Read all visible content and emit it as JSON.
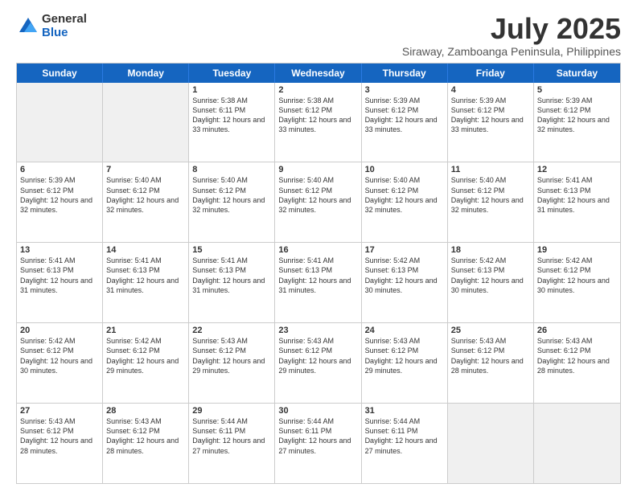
{
  "logo": {
    "general": "General",
    "blue": "Blue"
  },
  "title": "July 2025",
  "subtitle": "Siraway, Zamboanga Peninsula, Philippines",
  "headers": [
    "Sunday",
    "Monday",
    "Tuesday",
    "Wednesday",
    "Thursday",
    "Friday",
    "Saturday"
  ],
  "weeks": [
    [
      {
        "day": "",
        "info": "",
        "shaded": true
      },
      {
        "day": "",
        "info": "",
        "shaded": true
      },
      {
        "day": "1",
        "info": "Sunrise: 5:38 AM\nSunset: 6:11 PM\nDaylight: 12 hours and 33 minutes.",
        "shaded": false
      },
      {
        "day": "2",
        "info": "Sunrise: 5:38 AM\nSunset: 6:12 PM\nDaylight: 12 hours and 33 minutes.",
        "shaded": false
      },
      {
        "day": "3",
        "info": "Sunrise: 5:39 AM\nSunset: 6:12 PM\nDaylight: 12 hours and 33 minutes.",
        "shaded": false
      },
      {
        "day": "4",
        "info": "Sunrise: 5:39 AM\nSunset: 6:12 PM\nDaylight: 12 hours and 33 minutes.",
        "shaded": false
      },
      {
        "day": "5",
        "info": "Sunrise: 5:39 AM\nSunset: 6:12 PM\nDaylight: 12 hours and 32 minutes.",
        "shaded": false
      }
    ],
    [
      {
        "day": "6",
        "info": "Sunrise: 5:39 AM\nSunset: 6:12 PM\nDaylight: 12 hours and 32 minutes.",
        "shaded": false
      },
      {
        "day": "7",
        "info": "Sunrise: 5:40 AM\nSunset: 6:12 PM\nDaylight: 12 hours and 32 minutes.",
        "shaded": false
      },
      {
        "day": "8",
        "info": "Sunrise: 5:40 AM\nSunset: 6:12 PM\nDaylight: 12 hours and 32 minutes.",
        "shaded": false
      },
      {
        "day": "9",
        "info": "Sunrise: 5:40 AM\nSunset: 6:12 PM\nDaylight: 12 hours and 32 minutes.",
        "shaded": false
      },
      {
        "day": "10",
        "info": "Sunrise: 5:40 AM\nSunset: 6:12 PM\nDaylight: 12 hours and 32 minutes.",
        "shaded": false
      },
      {
        "day": "11",
        "info": "Sunrise: 5:40 AM\nSunset: 6:12 PM\nDaylight: 12 hours and 32 minutes.",
        "shaded": false
      },
      {
        "day": "12",
        "info": "Sunrise: 5:41 AM\nSunset: 6:13 PM\nDaylight: 12 hours and 31 minutes.",
        "shaded": false
      }
    ],
    [
      {
        "day": "13",
        "info": "Sunrise: 5:41 AM\nSunset: 6:13 PM\nDaylight: 12 hours and 31 minutes.",
        "shaded": false
      },
      {
        "day": "14",
        "info": "Sunrise: 5:41 AM\nSunset: 6:13 PM\nDaylight: 12 hours and 31 minutes.",
        "shaded": false
      },
      {
        "day": "15",
        "info": "Sunrise: 5:41 AM\nSunset: 6:13 PM\nDaylight: 12 hours and 31 minutes.",
        "shaded": false
      },
      {
        "day": "16",
        "info": "Sunrise: 5:41 AM\nSunset: 6:13 PM\nDaylight: 12 hours and 31 minutes.",
        "shaded": false
      },
      {
        "day": "17",
        "info": "Sunrise: 5:42 AM\nSunset: 6:13 PM\nDaylight: 12 hours and 30 minutes.",
        "shaded": false
      },
      {
        "day": "18",
        "info": "Sunrise: 5:42 AM\nSunset: 6:13 PM\nDaylight: 12 hours and 30 minutes.",
        "shaded": false
      },
      {
        "day": "19",
        "info": "Sunrise: 5:42 AM\nSunset: 6:12 PM\nDaylight: 12 hours and 30 minutes.",
        "shaded": false
      }
    ],
    [
      {
        "day": "20",
        "info": "Sunrise: 5:42 AM\nSunset: 6:12 PM\nDaylight: 12 hours and 30 minutes.",
        "shaded": false
      },
      {
        "day": "21",
        "info": "Sunrise: 5:42 AM\nSunset: 6:12 PM\nDaylight: 12 hours and 29 minutes.",
        "shaded": false
      },
      {
        "day": "22",
        "info": "Sunrise: 5:43 AM\nSunset: 6:12 PM\nDaylight: 12 hours and 29 minutes.",
        "shaded": false
      },
      {
        "day": "23",
        "info": "Sunrise: 5:43 AM\nSunset: 6:12 PM\nDaylight: 12 hours and 29 minutes.",
        "shaded": false
      },
      {
        "day": "24",
        "info": "Sunrise: 5:43 AM\nSunset: 6:12 PM\nDaylight: 12 hours and 29 minutes.",
        "shaded": false
      },
      {
        "day": "25",
        "info": "Sunrise: 5:43 AM\nSunset: 6:12 PM\nDaylight: 12 hours and 28 minutes.",
        "shaded": false
      },
      {
        "day": "26",
        "info": "Sunrise: 5:43 AM\nSunset: 6:12 PM\nDaylight: 12 hours and 28 minutes.",
        "shaded": false
      }
    ],
    [
      {
        "day": "27",
        "info": "Sunrise: 5:43 AM\nSunset: 6:12 PM\nDaylight: 12 hours and 28 minutes.",
        "shaded": false
      },
      {
        "day": "28",
        "info": "Sunrise: 5:43 AM\nSunset: 6:12 PM\nDaylight: 12 hours and 28 minutes.",
        "shaded": false
      },
      {
        "day": "29",
        "info": "Sunrise: 5:44 AM\nSunset: 6:11 PM\nDaylight: 12 hours and 27 minutes.",
        "shaded": false
      },
      {
        "day": "30",
        "info": "Sunrise: 5:44 AM\nSunset: 6:11 PM\nDaylight: 12 hours and 27 minutes.",
        "shaded": false
      },
      {
        "day": "31",
        "info": "Sunrise: 5:44 AM\nSunset: 6:11 PM\nDaylight: 12 hours and 27 minutes.",
        "shaded": false
      },
      {
        "day": "",
        "info": "",
        "shaded": true
      },
      {
        "day": "",
        "info": "",
        "shaded": true
      }
    ]
  ]
}
